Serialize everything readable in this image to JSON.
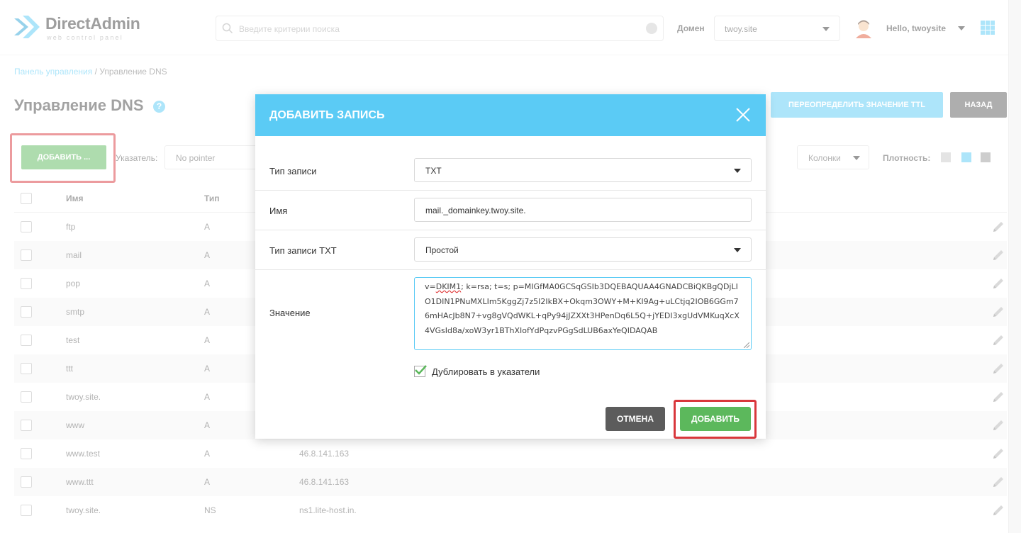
{
  "header": {
    "logo_name": "DirectAdmin",
    "logo_sub": "web control panel",
    "search_placeholder": "Введите критерии поиска",
    "domain_label": "Домен",
    "domain_value": "twoy.site",
    "user_greeting": "Hello, twoysite"
  },
  "breadcrumb": {
    "root": "Панель управления",
    "separator": " / ",
    "current": "Управление DNS"
  },
  "page": {
    "title": "Управление DNS",
    "ttl_button": "ПЕРЕОПРЕДЕЛИТЬ ЗНАЧЕНИЕ TTL",
    "back_button": "НАЗАД",
    "add_button": "ДОБАВИТЬ ...",
    "pointers_label": "Указатель:",
    "pointer_value": "No pointer",
    "columns_button": "Колонки",
    "density_label": "Плотность:"
  },
  "table": {
    "columns": [
      "Имя",
      "Тип"
    ],
    "rows": [
      {
        "name": "ftp",
        "type": "A",
        "value": ""
      },
      {
        "name": "mail",
        "type": "A",
        "value": ""
      },
      {
        "name": "pop",
        "type": "A",
        "value": ""
      },
      {
        "name": "smtp",
        "type": "A",
        "value": ""
      },
      {
        "name": "test",
        "type": "A",
        "value": ""
      },
      {
        "name": "ttt",
        "type": "A",
        "value": ""
      },
      {
        "name": "twoy.site.",
        "type": "A",
        "value": ""
      },
      {
        "name": "www",
        "type": "A",
        "value": ""
      },
      {
        "name": "www.test",
        "type": "A",
        "value": "46.8.141.163"
      },
      {
        "name": "www.ttt",
        "type": "A",
        "value": "46.8.141.163"
      },
      {
        "name": "twoy.site.",
        "type": "NS",
        "value": "ns1.lite-host.in."
      }
    ]
  },
  "modal": {
    "title": "ДОБАВИТЬ ЗАПИСЬ",
    "record_type_label": "Тип записи",
    "record_type_value": "TXT",
    "name_label": "Имя",
    "name_value": "mail._domainkey.twoy.site.",
    "txt_type_label": "Тип записи TXT",
    "txt_type_value": "Простой",
    "value_label": "Значение",
    "value_prefix": "v=",
    "value_spell": "DKIM1",
    "value_rest": "; k=rsa; t=s; p=MIGfMA0GCSqGSIb3DQEBAQUAA4GNADCBiQKBgQDjLIO1DIN1PNuMXLIm5KggZj7z5I2IkBX+Okqm3OWY+M+KI9Ag+uLCtjq2IOB6GGm76mHAcJb8N7+vg8gVQdWKL+qPy94jJZXXt3HPenDq6L5Q+jYEDI3xgUdVMKuqXcX4VGsId8a/xoW3yr1BThXIofYdPqzvPGgSdLUB6axYeQIDAQAB",
    "duplicate_label": "Дублировать в указатели",
    "duplicate_checked": true,
    "cancel_button": "ОТМЕНА",
    "submit_button": "ДОБАВИТЬ"
  },
  "colors": {
    "accent": "#5bcbf5",
    "success": "#5cb85c",
    "dark_button": "#5c5c5c",
    "highlight": "#d9373c"
  },
  "icons": [
    "logo-icon",
    "search-icon",
    "clear-icon",
    "chevron-down-icon",
    "avatar-icon",
    "apps-grid-icon",
    "help-icon",
    "pencil-icon",
    "close-icon",
    "checkmark-icon",
    "resize-handle-icon"
  ]
}
